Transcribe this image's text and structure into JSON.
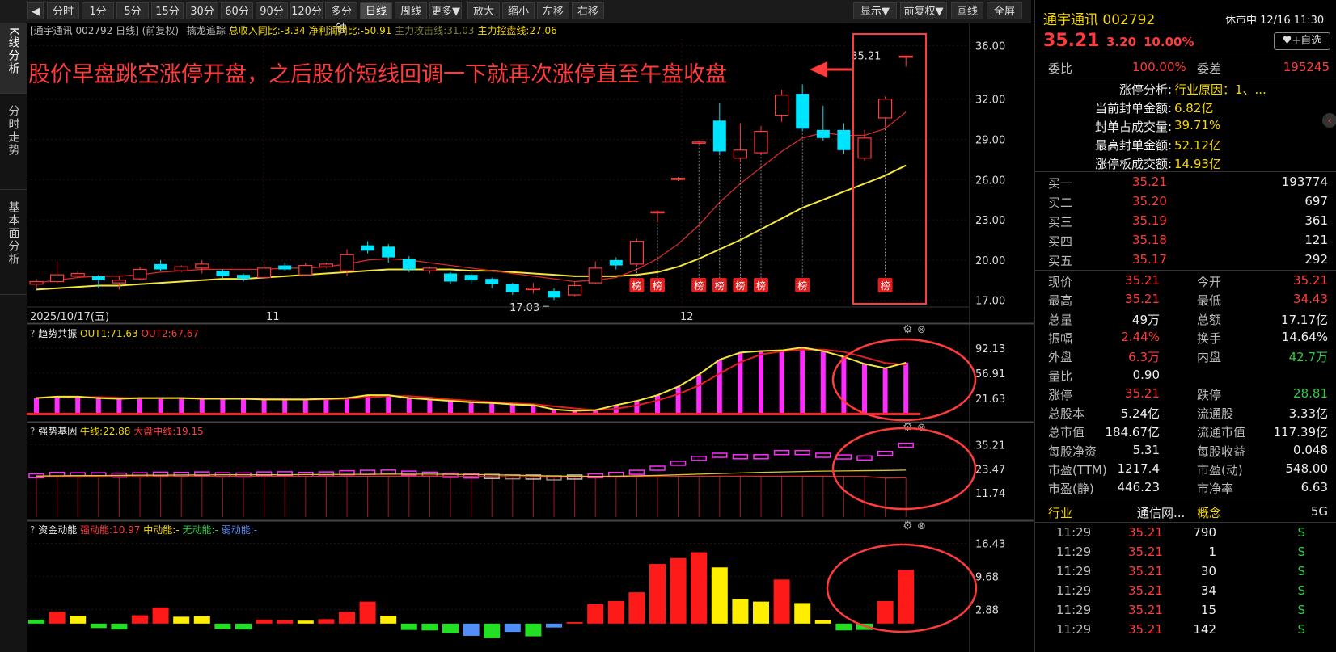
{
  "toolbar": {
    "back_icon": "left-arrow-icon",
    "periods": [
      "分时",
      "1分",
      "5分",
      "15分",
      "30分",
      "60分",
      "90分",
      "120分",
      "多分钟",
      "日线",
      "周线",
      "更多▼"
    ],
    "active_period": "日线",
    "actions": [
      "放大",
      "缩小",
      "左移",
      "右移"
    ],
    "right_buttons": [
      "显示▼",
      "前复权▼",
      "画线",
      "全屏"
    ]
  },
  "left_tabs": [
    "K线分析",
    "分时走势",
    "基本面分析"
  ],
  "main_header": {
    "stock_tag": "[通宇通讯 002792 日线]",
    "adjust": "(前复权)",
    "indicator": "擒龙追踪",
    "revenue_yoy": "总收入同比:-3.34",
    "profit_yoy": "净利润同比:-50.91",
    "attack_line": "主力攻击线:31.03",
    "control_line": "主力控盘线:27.06"
  },
  "annotation": "股价早盘跳空涨停开盘，之后股价短线回调一下就再次涨停直至午盘收盘",
  "chart_data": [
    {
      "type": "candlestick",
      "title": "",
      "y_ticks": [
        "36.00",
        "32.00",
        "29.00",
        "26.00",
        "23.00",
        "20.00",
        "17.00"
      ],
      "ylim": [
        16.5,
        36.5
      ],
      "x_labels": [
        "2025/10/17(五)",
        "11",
        "12"
      ],
      "low_label": "17.03",
      "last_label": "35.21",
      "candles": [
        {
          "o": 18.2,
          "c": 18.4,
          "h": 18.6,
          "l": 17.9
        },
        {
          "o": 18.4,
          "c": 18.9,
          "h": 19.9,
          "l": 18.3
        },
        {
          "o": 18.8,
          "c": 19.0,
          "h": 19.2,
          "l": 18.7
        },
        {
          "o": 18.8,
          "c": 18.5,
          "h": 18.9,
          "l": 17.9
        },
        {
          "o": 18.3,
          "c": 18.5,
          "h": 18.8,
          "l": 17.8
        },
        {
          "o": 18.6,
          "c": 19.3,
          "h": 19.5,
          "l": 18.5
        },
        {
          "o": 19.7,
          "c": 19.3,
          "h": 20.0,
          "l": 19.2
        },
        {
          "o": 19.2,
          "c": 19.5,
          "h": 19.6,
          "l": 19.1
        },
        {
          "o": 19.4,
          "c": 19.7,
          "h": 20.0,
          "l": 19.0
        },
        {
          "o": 19.2,
          "c": 18.8,
          "h": 19.3,
          "l": 18.6
        },
        {
          "o": 18.9,
          "c": 18.6,
          "h": 19.0,
          "l": 18.4
        },
        {
          "o": 18.7,
          "c": 19.4,
          "h": 19.7,
          "l": 18.6
        },
        {
          "o": 19.6,
          "c": 19.3,
          "h": 19.8,
          "l": 19.2
        },
        {
          "o": 18.9,
          "c": 19.6,
          "h": 19.8,
          "l": 18.8
        },
        {
          "o": 19.5,
          "c": 19.7,
          "h": 19.8,
          "l": 19.4
        },
        {
          "o": 19.2,
          "c": 20.4,
          "h": 20.8,
          "l": 18.8
        },
        {
          "o": 21.1,
          "c": 20.7,
          "h": 21.4,
          "l": 20.5
        },
        {
          "o": 21.0,
          "c": 20.2,
          "h": 21.2,
          "l": 19.8
        },
        {
          "o": 20.1,
          "c": 19.3,
          "h": 20.3,
          "l": 19.1
        },
        {
          "o": 19.2,
          "c": 19.4,
          "h": 19.5,
          "l": 19.0
        },
        {
          "o": 19.0,
          "c": 18.4,
          "h": 19.1,
          "l": 18.2
        },
        {
          "o": 18.9,
          "c": 18.5,
          "h": 19.0,
          "l": 18.2
        },
        {
          "o": 18.6,
          "c": 18.2,
          "h": 18.7,
          "l": 17.9
        },
        {
          "o": 18.2,
          "c": 17.6,
          "h": 18.3,
          "l": 17.4
        },
        {
          "o": 17.8,
          "c": 17.9,
          "h": 18.3,
          "l": 17.5
        },
        {
          "o": 17.7,
          "c": 17.2,
          "h": 17.9,
          "l": 17.03
        },
        {
          "o": 17.4,
          "c": 18.1,
          "h": 18.4,
          "l": 17.3
        },
        {
          "o": 18.3,
          "c": 19.4,
          "h": 19.9,
          "l": 18.2
        },
        {
          "o": 20.0,
          "c": 19.6,
          "h": 20.2,
          "l": 19.3
        },
        {
          "o": 19.7,
          "c": 21.4,
          "h": 21.6,
          "l": 19.5
        },
        {
          "o": 23.6,
          "c": 23.6,
          "h": 23.7,
          "l": 22.8
        },
        {
          "o": 26.1,
          "c": 26.1,
          "h": 26.2,
          "l": 25.9
        },
        {
          "o": 28.8,
          "c": 28.8,
          "h": 28.9,
          "l": 28.5
        },
        {
          "o": 30.4,
          "c": 28.1,
          "h": 31.7,
          "l": 27.8
        },
        {
          "o": 27.6,
          "c": 28.2,
          "h": 30.2,
          "l": 27.3
        },
        {
          "o": 28.0,
          "c": 29.6,
          "h": 30.0,
          "l": 27.8
        },
        {
          "o": 30.8,
          "c": 32.3,
          "h": 32.7,
          "l": 30.3
        },
        {
          "o": 32.4,
          "c": 29.8,
          "h": 33.1,
          "l": 29.6
        },
        {
          "o": 29.7,
          "c": 29.1,
          "h": 31.5,
          "l": 28.9
        },
        {
          "o": 29.7,
          "c": 28.2,
          "h": 30.2,
          "l": 27.9
        },
        {
          "o": 27.6,
          "c": 29.1,
          "h": 29.7,
          "l": 27.4
        },
        {
          "o": 30.6,
          "c": 32.0,
          "h": 32.2,
          "l": 29.9
        },
        {
          "o": 35.21,
          "c": 35.21,
          "h": 35.21,
          "l": 34.43
        }
      ],
      "ma_red": [
        18.3,
        18.5,
        18.7,
        18.8,
        18.8,
        18.9,
        19.1,
        19.2,
        19.3,
        19.3,
        19.3,
        19.3,
        19.4,
        19.4,
        19.5,
        19.7,
        20.0,
        20.1,
        20.0,
        19.8,
        19.6,
        19.4,
        19.2,
        19.0,
        18.8,
        18.6,
        18.4,
        18.5,
        18.7,
        19.3,
        20.1,
        21.2,
        22.6,
        24.3,
        25.7,
        26.9,
        28.1,
        29.1,
        29.5,
        29.3,
        29.3,
        29.8,
        31.03
      ],
      "ma_yellow": [
        17.8,
        17.9,
        18.0,
        18.1,
        18.1,
        18.2,
        18.3,
        18.4,
        18.5,
        18.6,
        18.6,
        18.7,
        18.8,
        18.9,
        19.0,
        19.1,
        19.2,
        19.3,
        19.3,
        19.3,
        19.3,
        19.2,
        19.2,
        19.1,
        19.0,
        18.9,
        18.8,
        18.8,
        18.8,
        18.9,
        19.1,
        19.5,
        20.1,
        20.8,
        21.5,
        22.3,
        23.1,
        23.9,
        24.5,
        25.1,
        25.7,
        26.3,
        27.06
      ],
      "tags": {
        "label": "榜",
        "indices": [
          29,
          30,
          32,
          33,
          34,
          35,
          37,
          41
        ]
      }
    },
    {
      "type": "bar",
      "title": "趋势共振",
      "legend": [
        "OUT1:71.63",
        "OUT2:67.67"
      ],
      "y_ticks": [
        "92.13",
        "56.91",
        "21.63"
      ],
      "ylim": [
        0,
        100
      ],
      "values": [
        22,
        24,
        24,
        22,
        21,
        22,
        22,
        22,
        21,
        21,
        21,
        20,
        20,
        20,
        21,
        22,
        26,
        26,
        22,
        20,
        18,
        16,
        15,
        13,
        12,
        6,
        4,
        5,
        12,
        18,
        26,
        38,
        55,
        76,
        86,
        88,
        89,
        93,
        88,
        80,
        70,
        64,
        71.63
      ]
    },
    {
      "type": "bar",
      "title": "强势基因",
      "legend": [
        "牛线:22.88",
        "大盘中线:19.15"
      ],
      "y_ticks": [
        "35.21",
        "23.47",
        "11.74"
      ],
      "ylim": [
        0,
        37
      ],
      "values": [
        20.3,
        21.0,
        20.8,
        20.8,
        20.6,
        20.8,
        21.1,
        21.0,
        21.2,
        20.8,
        20.7,
        21.2,
        21.3,
        21.0,
        21.2,
        21.8,
        22.0,
        22.1,
        21.6,
        21.1,
        20.5,
        20.2,
        20.0,
        19.8,
        19.7,
        19.3,
        19.7,
        20.3,
        21.0,
        22.0,
        24.0,
        26.4,
        28.8,
        30.3,
        29.6,
        29.6,
        31.6,
        31.6,
        30.3,
        29.5,
        29.0,
        31.2,
        35.2
      ],
      "niu_line": [
        20.0,
        20.1,
        20.2,
        20.2,
        20.3,
        20.4,
        20.4,
        20.5,
        20.5,
        20.6,
        20.6,
        20.6,
        20.6,
        20.7,
        20.7,
        20.8,
        20.8,
        20.9,
        20.9,
        20.9,
        20.8,
        20.7,
        20.6,
        20.4,
        20.2,
        20.0,
        19.9,
        19.8,
        19.9,
        20.1,
        20.3,
        20.6,
        20.9,
        21.2,
        21.5,
        21.8,
        22.0,
        22.2,
        22.4,
        22.5,
        22.6,
        22.7,
        22.88
      ],
      "dapan_line": [
        19.6,
        19.6,
        19.6,
        19.7,
        19.7,
        19.7,
        19.7,
        19.7,
        19.8,
        19.8,
        19.8,
        19.8,
        19.8,
        19.8,
        19.8,
        19.9,
        19.9,
        19.9,
        19.9,
        19.9,
        19.8,
        19.8,
        19.7,
        19.6,
        19.6,
        19.5,
        19.5,
        19.5,
        19.5,
        19.6,
        19.7,
        19.8,
        19.8,
        19.9,
        19.9,
        19.9,
        19.9,
        19.9,
        19.9,
        19.8,
        19.8,
        19.0,
        19.15
      ]
    },
    {
      "type": "bar",
      "title": "资金动能",
      "legend": [
        "强动能:10.97",
        "中动能:-",
        "无动能:-",
        "弱动能:-"
      ],
      "y_ticks": [
        "16.43",
        "9.68",
        "2.88"
      ],
      "ylim": [
        -3.5,
        17
      ],
      "values": [
        0.8,
        2.4,
        1.6,
        -0.9,
        -1.2,
        1.7,
        3.3,
        1.4,
        1.5,
        -1.1,
        -1.2,
        0.8,
        0.7,
        0.6,
        0.9,
        2.4,
        4.5,
        1.6,
        -1.3,
        -1.4,
        -2.0,
        -2.5,
        -3.0,
        -1.7,
        -2.6,
        -0.8,
        0.3,
        4.0,
        4.6,
        6.4,
        12.2,
        13.4,
        14.6,
        11.5,
        5.0,
        4.5,
        9.0,
        4.2,
        0.7,
        -1.4,
        -1.3,
        4.6,
        10.97
      ],
      "colors": [
        "g",
        "r",
        "y",
        "g",
        "g",
        "r",
        "r",
        "y",
        "y",
        "g",
        "g",
        "r",
        "r",
        "y",
        "r",
        "r",
        "r",
        "y",
        "g",
        "g",
        "g",
        "b",
        "g",
        "b",
        "g",
        "b",
        "r",
        "r",
        "r",
        "r",
        "r",
        "r",
        "r",
        "y",
        "y",
        "y",
        "r",
        "y",
        "y",
        "g",
        "g",
        "r",
        "r"
      ]
    }
  ],
  "rp": {
    "name": "通宇通讯 002792",
    "status": "休市中 12/16 11:30",
    "price": "35.21",
    "change": "3.20",
    "pct": "10.00%",
    "watch_btn": "+自选",
    "weibi_label": "委比",
    "weibi": "100.00%",
    "weicha_label": "委差",
    "weicha": "195245",
    "limit_rows": [
      {
        "k": "涨停分析:",
        "v": "行业原因：1、..."
      },
      {
        "k": "当前封单金额:",
        "v": "6.82亿"
      },
      {
        "k": "封单占成交量:",
        "v": "39.71%"
      },
      {
        "k": "最高封单金额:",
        "v": "52.12亿"
      },
      {
        "k": "涨停板成交额:",
        "v": "14.93亿"
      }
    ],
    "bids": [
      {
        "label": "买一",
        "price": "35.21",
        "vol": "193774"
      },
      {
        "label": "买二",
        "price": "35.20",
        "vol": "697"
      },
      {
        "label": "买三",
        "price": "35.19",
        "vol": "361"
      },
      {
        "label": "买四",
        "price": "35.18",
        "vol": "121"
      },
      {
        "label": "买五",
        "price": "35.17",
        "vol": "292"
      }
    ],
    "quote_rows": [
      {
        "k1": "现价",
        "v1": "35.21",
        "c1": "red",
        "k2": "今开",
        "v2": "35.21",
        "c2": "red"
      },
      {
        "k1": "最高",
        "v1": "35.21",
        "c1": "red",
        "k2": "最低",
        "v2": "34.43",
        "c2": "red"
      },
      {
        "k1": "总量",
        "v1": "49万",
        "c1": "white",
        "k2": "总额",
        "v2": "17.17亿",
        "c2": "white"
      },
      {
        "k1": "振幅",
        "v1": "2.44%",
        "c1": "red",
        "k2": "换手",
        "v2": "14.64%",
        "c2": "white"
      },
      {
        "k1": "外盘",
        "v1": "6.3万",
        "c1": "red",
        "k2": "内盘",
        "v2": "42.7万",
        "c2": "green"
      },
      {
        "k1": "量比",
        "v1": "0.90",
        "c1": "white",
        "k2": "",
        "v2": "",
        "c2": "white"
      },
      {
        "k1": "涨停",
        "v1": "35.21",
        "c1": "red",
        "k2": "跌停",
        "v2": "28.81",
        "c2": "green"
      },
      {
        "k1": "总股本",
        "v1": "5.24亿",
        "c1": "white",
        "k2": "流通股",
        "v2": "3.33亿",
        "c2": "white"
      },
      {
        "k1": "总市值",
        "v1": "184.67亿",
        "c1": "white",
        "k2": "流通市值",
        "v2": "117.39亿",
        "c2": "white"
      },
      {
        "k1": "每股净资",
        "v1": "5.31",
        "c1": "white",
        "k2": "每股收益",
        "v2": "0.048",
        "c2": "white"
      },
      {
        "k1": "市盈(TTM)",
        "v1": "1217.4",
        "c1": "white",
        "k2": "市盈(动)",
        "v2": "548.00",
        "c2": "white"
      },
      {
        "k1": "市盈(静)",
        "v1": "446.23",
        "c1": "white",
        "k2": "市净率",
        "v2": "6.63",
        "c2": "white"
      }
    ],
    "industry_label": "行业",
    "industry": "通信网...",
    "concept_label": "概念",
    "concept": "5G",
    "ticks": [
      {
        "t": "11:29",
        "p": "35.21",
        "v": "790",
        "s": "S"
      },
      {
        "t": "11:29",
        "p": "35.21",
        "v": "1",
        "s": "S"
      },
      {
        "t": "11:29",
        "p": "35.21",
        "v": "30",
        "s": "S"
      },
      {
        "t": "11:29",
        "p": "35.21",
        "v": "34",
        "s": "S"
      },
      {
        "t": "11:29",
        "p": "35.21",
        "v": "15",
        "s": "S"
      },
      {
        "t": "11:29",
        "p": "35.21",
        "v": "142",
        "s": "S"
      }
    ]
  },
  "colors": {
    "up": "#ff3b3b",
    "down": "#00e5ff",
    "ma_yellow": "#f5e63a",
    "magenta": "#ff2bff",
    "annot": "#ff3b3b"
  }
}
